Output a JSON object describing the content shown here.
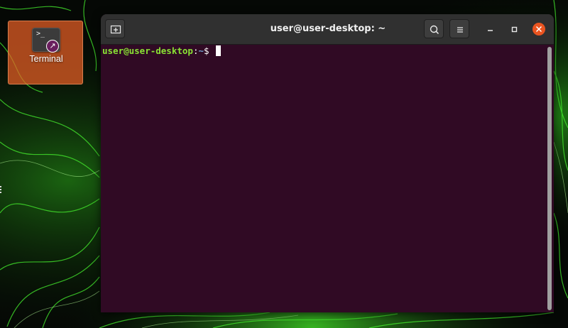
{
  "desktop": {
    "icon_label": "Terminal",
    "icon_glyph": ">_",
    "link_badge": "↗",
    "colors": {
      "icon_bg": "#e95f26",
      "wallpaper_accent": "#3bff2a"
    }
  },
  "window": {
    "title": "user@user-desktop: ~",
    "icons": {
      "new_tab": "new-tab-icon",
      "search": "search-icon",
      "menu": "hamburger-menu-icon",
      "minimize": "minimize-icon",
      "maximize": "maximize-icon",
      "close": "close-icon"
    },
    "colors": {
      "titlebar": "#303030",
      "close": "#e95420",
      "terminal_bg": "#300a24"
    }
  },
  "terminal": {
    "prompt_user": "user@user-desktop",
    "prompt_colon": ":",
    "prompt_path": "~",
    "prompt_symbol": "$",
    "colors": {
      "user": "#8ae234",
      "path": "#729fcf",
      "text": "#ffffff"
    }
  }
}
